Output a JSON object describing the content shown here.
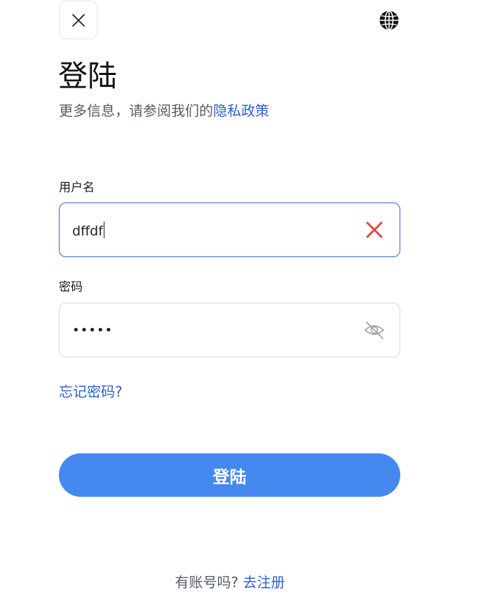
{
  "header": {
    "close_icon": "close-icon",
    "language_icon": "globe-icon"
  },
  "title": "登陆",
  "subtitle": {
    "prefix": "更多信息，请参阅我们的",
    "link": "隐私政策"
  },
  "form": {
    "username": {
      "label": "用户名",
      "value": "dffdf",
      "clear_icon": "clear-icon",
      "clear_color": "#e0483e"
    },
    "password": {
      "label": "密码",
      "masked_value": "•••••",
      "toggle_icon": "eye-off-icon"
    },
    "forgot_link": "忘记密码?",
    "submit_label": "登陆"
  },
  "footer": {
    "prompt": "有账号吗?",
    "register_link": "去注册"
  },
  "colors": {
    "accent": "#4589f0",
    "link": "#2f5fd0",
    "focus_border": "#3a63d6"
  }
}
